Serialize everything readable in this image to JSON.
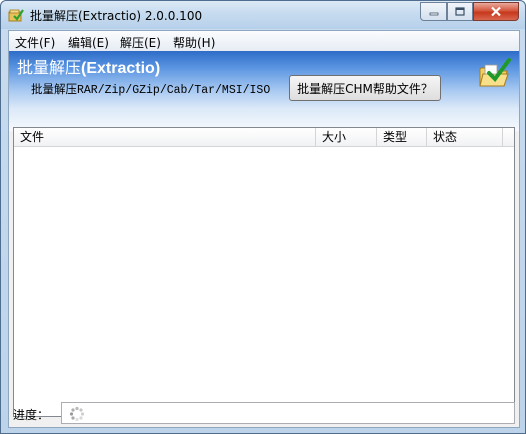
{
  "window": {
    "title": "批量解压(Extractio) 2.0.0.100",
    "app_icon": "app-icon"
  },
  "menu": [
    {
      "label": "文件(F)"
    },
    {
      "label": "编辑(E)"
    },
    {
      "label": "解压(E)"
    },
    {
      "label": "帮助(H)"
    }
  ],
  "banner": {
    "title_prefix": "批量解压",
    "title_bold": "(Extractio)",
    "subtitle": "批量解压RAR/Zip/GZip/Cab/Tar/MSI/ISO",
    "help_button": "批量解压CHM帮助文件？",
    "icon": "folder-check-icon"
  },
  "list": {
    "columns": [
      {
        "label": "文件"
      },
      {
        "label": "大小"
      },
      {
        "label": "类型"
      },
      {
        "label": "状态"
      }
    ],
    "rows": []
  },
  "status": {
    "progress_label": "进度："
  },
  "colors": {
    "banner_top": "#2e6cc8",
    "banner_bottom": "#f6f9fd",
    "close_button": "#c7381c"
  }
}
